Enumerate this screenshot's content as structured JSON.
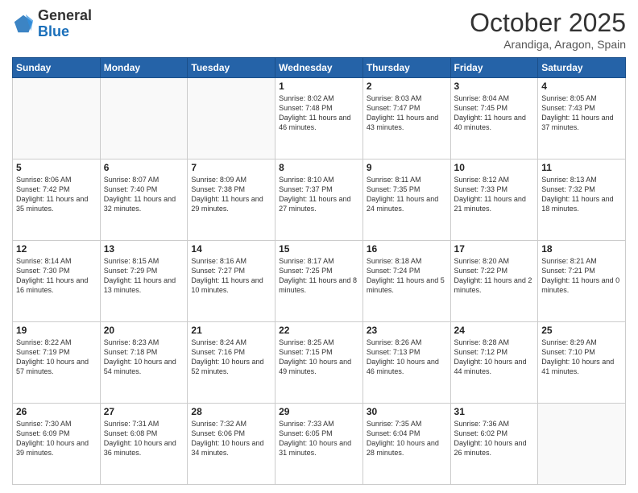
{
  "logo": {
    "general": "General",
    "blue": "Blue"
  },
  "header": {
    "month": "October 2025",
    "location": "Arandiga, Aragon, Spain"
  },
  "days_of_week": [
    "Sunday",
    "Monday",
    "Tuesday",
    "Wednesday",
    "Thursday",
    "Friday",
    "Saturday"
  ],
  "weeks": [
    [
      {
        "day": "",
        "sunrise": "",
        "sunset": "",
        "daylight": ""
      },
      {
        "day": "",
        "sunrise": "",
        "sunset": "",
        "daylight": ""
      },
      {
        "day": "",
        "sunrise": "",
        "sunset": "",
        "daylight": ""
      },
      {
        "day": "1",
        "sunrise": "Sunrise: 8:02 AM",
        "sunset": "Sunset: 7:48 PM",
        "daylight": "Daylight: 11 hours and 46 minutes."
      },
      {
        "day": "2",
        "sunrise": "Sunrise: 8:03 AM",
        "sunset": "Sunset: 7:47 PM",
        "daylight": "Daylight: 11 hours and 43 minutes."
      },
      {
        "day": "3",
        "sunrise": "Sunrise: 8:04 AM",
        "sunset": "Sunset: 7:45 PM",
        "daylight": "Daylight: 11 hours and 40 minutes."
      },
      {
        "day": "4",
        "sunrise": "Sunrise: 8:05 AM",
        "sunset": "Sunset: 7:43 PM",
        "daylight": "Daylight: 11 hours and 37 minutes."
      }
    ],
    [
      {
        "day": "5",
        "sunrise": "Sunrise: 8:06 AM",
        "sunset": "Sunset: 7:42 PM",
        "daylight": "Daylight: 11 hours and 35 minutes."
      },
      {
        "day": "6",
        "sunrise": "Sunrise: 8:07 AM",
        "sunset": "Sunset: 7:40 PM",
        "daylight": "Daylight: 11 hours and 32 minutes."
      },
      {
        "day": "7",
        "sunrise": "Sunrise: 8:09 AM",
        "sunset": "Sunset: 7:38 PM",
        "daylight": "Daylight: 11 hours and 29 minutes."
      },
      {
        "day": "8",
        "sunrise": "Sunrise: 8:10 AM",
        "sunset": "Sunset: 7:37 PM",
        "daylight": "Daylight: 11 hours and 27 minutes."
      },
      {
        "day": "9",
        "sunrise": "Sunrise: 8:11 AM",
        "sunset": "Sunset: 7:35 PM",
        "daylight": "Daylight: 11 hours and 24 minutes."
      },
      {
        "day": "10",
        "sunrise": "Sunrise: 8:12 AM",
        "sunset": "Sunset: 7:33 PM",
        "daylight": "Daylight: 11 hours and 21 minutes."
      },
      {
        "day": "11",
        "sunrise": "Sunrise: 8:13 AM",
        "sunset": "Sunset: 7:32 PM",
        "daylight": "Daylight: 11 hours and 18 minutes."
      }
    ],
    [
      {
        "day": "12",
        "sunrise": "Sunrise: 8:14 AM",
        "sunset": "Sunset: 7:30 PM",
        "daylight": "Daylight: 11 hours and 16 minutes."
      },
      {
        "day": "13",
        "sunrise": "Sunrise: 8:15 AM",
        "sunset": "Sunset: 7:29 PM",
        "daylight": "Daylight: 11 hours and 13 minutes."
      },
      {
        "day": "14",
        "sunrise": "Sunrise: 8:16 AM",
        "sunset": "Sunset: 7:27 PM",
        "daylight": "Daylight: 11 hours and 10 minutes."
      },
      {
        "day": "15",
        "sunrise": "Sunrise: 8:17 AM",
        "sunset": "Sunset: 7:25 PM",
        "daylight": "Daylight: 11 hours and 8 minutes."
      },
      {
        "day": "16",
        "sunrise": "Sunrise: 8:18 AM",
        "sunset": "Sunset: 7:24 PM",
        "daylight": "Daylight: 11 hours and 5 minutes."
      },
      {
        "day": "17",
        "sunrise": "Sunrise: 8:20 AM",
        "sunset": "Sunset: 7:22 PM",
        "daylight": "Daylight: 11 hours and 2 minutes."
      },
      {
        "day": "18",
        "sunrise": "Sunrise: 8:21 AM",
        "sunset": "Sunset: 7:21 PM",
        "daylight": "Daylight: 11 hours and 0 minutes."
      }
    ],
    [
      {
        "day": "19",
        "sunrise": "Sunrise: 8:22 AM",
        "sunset": "Sunset: 7:19 PM",
        "daylight": "Daylight: 10 hours and 57 minutes."
      },
      {
        "day": "20",
        "sunrise": "Sunrise: 8:23 AM",
        "sunset": "Sunset: 7:18 PM",
        "daylight": "Daylight: 10 hours and 54 minutes."
      },
      {
        "day": "21",
        "sunrise": "Sunrise: 8:24 AM",
        "sunset": "Sunset: 7:16 PM",
        "daylight": "Daylight: 10 hours and 52 minutes."
      },
      {
        "day": "22",
        "sunrise": "Sunrise: 8:25 AM",
        "sunset": "Sunset: 7:15 PM",
        "daylight": "Daylight: 10 hours and 49 minutes."
      },
      {
        "day": "23",
        "sunrise": "Sunrise: 8:26 AM",
        "sunset": "Sunset: 7:13 PM",
        "daylight": "Daylight: 10 hours and 46 minutes."
      },
      {
        "day": "24",
        "sunrise": "Sunrise: 8:28 AM",
        "sunset": "Sunset: 7:12 PM",
        "daylight": "Daylight: 10 hours and 44 minutes."
      },
      {
        "day": "25",
        "sunrise": "Sunrise: 8:29 AM",
        "sunset": "Sunset: 7:10 PM",
        "daylight": "Daylight: 10 hours and 41 minutes."
      }
    ],
    [
      {
        "day": "26",
        "sunrise": "Sunrise: 7:30 AM",
        "sunset": "Sunset: 6:09 PM",
        "daylight": "Daylight: 10 hours and 39 minutes."
      },
      {
        "day": "27",
        "sunrise": "Sunrise: 7:31 AM",
        "sunset": "Sunset: 6:08 PM",
        "daylight": "Daylight: 10 hours and 36 minutes."
      },
      {
        "day": "28",
        "sunrise": "Sunrise: 7:32 AM",
        "sunset": "Sunset: 6:06 PM",
        "daylight": "Daylight: 10 hours and 34 minutes."
      },
      {
        "day": "29",
        "sunrise": "Sunrise: 7:33 AM",
        "sunset": "Sunset: 6:05 PM",
        "daylight": "Daylight: 10 hours and 31 minutes."
      },
      {
        "day": "30",
        "sunrise": "Sunrise: 7:35 AM",
        "sunset": "Sunset: 6:04 PM",
        "daylight": "Daylight: 10 hours and 28 minutes."
      },
      {
        "day": "31",
        "sunrise": "Sunrise: 7:36 AM",
        "sunset": "Sunset: 6:02 PM",
        "daylight": "Daylight: 10 hours and 26 minutes."
      },
      {
        "day": "",
        "sunrise": "",
        "sunset": "",
        "daylight": ""
      }
    ]
  ]
}
